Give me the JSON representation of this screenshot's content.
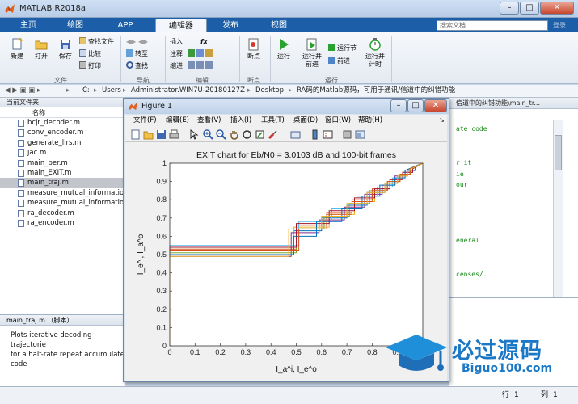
{
  "app": {
    "title": "MATLAB R2018a"
  },
  "tabs": [
    {
      "label": "主页",
      "active": false
    },
    {
      "label": "绘图",
      "active": false
    },
    {
      "label": "APP",
      "active": false
    },
    {
      "label": "编辑器",
      "active": true
    },
    {
      "label": "发布",
      "active": false
    },
    {
      "label": "视图",
      "active": false
    }
  ],
  "search": {
    "placeholder": "搜索文档"
  },
  "login_label": "登录",
  "window_controls": {
    "minimize": "–",
    "maximize": "□",
    "close": "✕"
  },
  "ribbon": {
    "file": {
      "new": "新建",
      "open": "打开",
      "save": "保存",
      "find_files": "查找文件",
      "compare": "比较",
      "print": "打印",
      "group": "文件"
    },
    "nav": {
      "goto": "转至",
      "find": "查找",
      "group": "导航"
    },
    "edit": {
      "insert": "插入",
      "fx": "fx",
      "comment": "注释",
      "indent": "缩进",
      "group": "编辑"
    },
    "breakpoints": {
      "label": "断点",
      "group": "断点"
    },
    "run": {
      "run": "运行",
      "run_advance": "运行并\n前进",
      "run_section": "运行节",
      "advance": "前进",
      "run_time": "运行并\n计时",
      "group": "运行"
    }
  },
  "path": {
    "segments": [
      "C:",
      "Users",
      "Administrator.WIN7U-20180127Z",
      "Desktop",
      "RA码的Matlab源码，可用于通讯/信道中的纠错功能"
    ]
  },
  "current_folder": {
    "title": "当前文件夹",
    "column": "名称",
    "files": [
      {
        "name": "bcjr_decoder.m",
        "selected": false
      },
      {
        "name": "conv_encoder.m",
        "selected": false
      },
      {
        "name": "generate_llrs.m",
        "selected": false
      },
      {
        "name": "jac.m",
        "selected": false
      },
      {
        "name": "main_ber.m",
        "selected": false
      },
      {
        "name": "main_EXIT.m",
        "selected": false
      },
      {
        "name": "main_traj.m",
        "selected": true
      },
      {
        "name": "measure_mutual_information",
        "selected": false
      },
      {
        "name": "measure_mutual_information",
        "selected": false
      },
      {
        "name": "ra_decoder.m",
        "selected": false
      },
      {
        "name": "ra_encoder.m",
        "selected": false
      }
    ]
  },
  "details": {
    "header": "main_traj.m （脚本）",
    "lines": [
      "Plots iterative decoding trajectorie",
      "for a half-rate repeat accumulate",
      "code"
    ]
  },
  "editor": {
    "tab": "信道中的纠错功能\\main_tr...",
    "lines": [
      "ate code",
      "r it",
      "ie",
      "our",
      "eneral",
      "censes/."
    ]
  },
  "status": {
    "line_label": "行",
    "line_value": "1",
    "col_label": "列",
    "col_value": "1"
  },
  "figure": {
    "title": "Figure 1",
    "menu": [
      "文件(F)",
      "编辑(E)",
      "查看(V)",
      "插入(I)",
      "工具(T)",
      "桌面(D)",
      "窗口(W)",
      "帮助(H)"
    ],
    "controls": {
      "minimize": "–",
      "maximize": "□",
      "close": "✕"
    }
  },
  "chart_data": {
    "type": "line",
    "title": "EXIT chart for Eb/N0 = 3.0103 dB and 100-bit frames",
    "xlabel": "I_a^i, I_e^o",
    "ylabel": "I_e^i, I_a^o",
    "xlim": [
      0,
      1
    ],
    "ylim": [
      0,
      1
    ],
    "xticks": [
      0,
      0.1,
      0.2,
      0.3,
      0.4,
      0.5,
      0.6,
      0.7,
      0.8,
      0.9
    ],
    "yticks": [
      0,
      0.1,
      0.2,
      0.3,
      0.4,
      0.5,
      0.6,
      0.7,
      0.8,
      0.9,
      1
    ],
    "grid": false,
    "series": [
      {
        "color": "#0072bd",
        "points": [
          [
            0,
            0
          ],
          [
            0,
            0.5
          ],
          [
            0.49,
            0.5
          ],
          [
            0.49,
            0.63
          ],
          [
            0.6,
            0.63
          ],
          [
            0.6,
            0.7
          ],
          [
            0.7,
            0.7
          ],
          [
            0.7,
            0.77
          ],
          [
            0.78,
            0.77
          ],
          [
            0.78,
            0.84
          ],
          [
            0.85,
            0.84
          ],
          [
            0.85,
            0.89
          ],
          [
            0.9,
            0.89
          ],
          [
            0.9,
            0.93
          ],
          [
            0.94,
            0.93
          ],
          [
            0.94,
            0.96
          ],
          [
            0.97,
            0.96
          ],
          [
            0.97,
            0.98
          ],
          [
            1,
            1
          ]
        ]
      },
      {
        "color": "#d95319",
        "points": [
          [
            0,
            0
          ],
          [
            0,
            0.53
          ],
          [
            0.5,
            0.53
          ],
          [
            0.5,
            0.66
          ],
          [
            0.62,
            0.66
          ],
          [
            0.62,
            0.73
          ],
          [
            0.72,
            0.73
          ],
          [
            0.72,
            0.8
          ],
          [
            0.8,
            0.8
          ],
          [
            0.8,
            0.86
          ],
          [
            0.87,
            0.86
          ],
          [
            0.87,
            0.91
          ],
          [
            0.92,
            0.91
          ],
          [
            0.92,
            0.95
          ],
          [
            0.96,
            0.95
          ],
          [
            0.96,
            0.98
          ],
          [
            1,
            1
          ]
        ]
      },
      {
        "color": "#edb120",
        "points": [
          [
            0,
            0
          ],
          [
            0,
            0.52
          ],
          [
            0.49,
            0.52
          ],
          [
            0.49,
            0.65
          ],
          [
            0.63,
            0.65
          ],
          [
            0.63,
            0.72
          ],
          [
            0.73,
            0.72
          ],
          [
            0.73,
            0.79
          ],
          [
            0.81,
            0.79
          ],
          [
            0.81,
            0.85
          ],
          [
            0.86,
            0.85
          ],
          [
            0.86,
            0.9
          ],
          [
            0.91,
            0.9
          ],
          [
            0.91,
            0.94
          ],
          [
            0.95,
            0.94
          ],
          [
            0.95,
            0.97
          ],
          [
            1,
            1
          ]
        ]
      },
      {
        "color": "#7e2f8e",
        "points": [
          [
            0,
            0
          ],
          [
            0,
            0.49
          ],
          [
            0.48,
            0.49
          ],
          [
            0.48,
            0.62
          ],
          [
            0.59,
            0.62
          ],
          [
            0.59,
            0.69
          ],
          [
            0.69,
            0.69
          ],
          [
            0.69,
            0.76
          ],
          [
            0.77,
            0.76
          ],
          [
            0.77,
            0.83
          ],
          [
            0.84,
            0.83
          ],
          [
            0.84,
            0.88
          ],
          [
            0.89,
            0.88
          ],
          [
            0.89,
            0.93
          ],
          [
            0.93,
            0.93
          ],
          [
            0.93,
            0.96
          ],
          [
            1,
            1
          ]
        ]
      },
      {
        "color": "#77ac30",
        "points": [
          [
            0,
            0
          ],
          [
            0,
            0.51
          ],
          [
            0.5,
            0.51
          ],
          [
            0.5,
            0.64
          ],
          [
            0.61,
            0.64
          ],
          [
            0.61,
            0.71
          ],
          [
            0.71,
            0.71
          ],
          [
            0.71,
            0.78
          ],
          [
            0.79,
            0.78
          ],
          [
            0.79,
            0.85
          ],
          [
            0.86,
            0.85
          ],
          [
            0.86,
            0.9
          ],
          [
            0.91,
            0.9
          ],
          [
            0.91,
            0.94
          ],
          [
            0.95,
            0.94
          ],
          [
            0.95,
            0.97
          ],
          [
            1,
            1
          ]
        ]
      },
      {
        "color": "#4dbeee",
        "points": [
          [
            0,
            0
          ],
          [
            0,
            0.55
          ],
          [
            0.51,
            0.55
          ],
          [
            0.51,
            0.68
          ],
          [
            0.64,
            0.68
          ],
          [
            0.64,
            0.75
          ],
          [
            0.74,
            0.75
          ],
          [
            0.74,
            0.82
          ],
          [
            0.82,
            0.82
          ],
          [
            0.82,
            0.87
          ],
          [
            0.88,
            0.87
          ],
          [
            0.88,
            0.92
          ],
          [
            0.93,
            0.92
          ],
          [
            0.93,
            0.95
          ],
          [
            0.96,
            0.95
          ],
          [
            0.96,
            0.98
          ],
          [
            1,
            1
          ]
        ]
      },
      {
        "color": "#a2142f",
        "points": [
          [
            0,
            0
          ],
          [
            0,
            0.54
          ],
          [
            0.5,
            0.54
          ],
          [
            0.5,
            0.67
          ],
          [
            0.63,
            0.67
          ],
          [
            0.63,
            0.74
          ],
          [
            0.73,
            0.74
          ],
          [
            0.73,
            0.81
          ],
          [
            0.81,
            0.81
          ],
          [
            0.81,
            0.86
          ],
          [
            0.87,
            0.86
          ],
          [
            0.87,
            0.91
          ],
          [
            0.92,
            0.91
          ],
          [
            0.92,
            0.95
          ],
          [
            0.96,
            0.95
          ],
          [
            0.96,
            0.97
          ],
          [
            1,
            1
          ]
        ]
      },
      {
        "color": "#0072bd",
        "points": [
          [
            0,
            0
          ],
          [
            0,
            0.5
          ],
          [
            0.49,
            0.5
          ],
          [
            0.49,
            0.6
          ],
          [
            0.58,
            0.6
          ],
          [
            0.58,
            0.68
          ],
          [
            0.68,
            0.68
          ],
          [
            0.68,
            0.75
          ],
          [
            0.76,
            0.75
          ],
          [
            0.76,
            0.82
          ],
          [
            0.83,
            0.82
          ],
          [
            0.83,
            0.88
          ],
          [
            0.89,
            0.88
          ],
          [
            0.89,
            0.92
          ],
          [
            0.93,
            0.92
          ],
          [
            0.93,
            0.96
          ],
          [
            1,
            1
          ]
        ]
      },
      {
        "color": "#d95319",
        "points": [
          [
            0,
            0
          ],
          [
            0,
            0.52
          ],
          [
            0.51,
            0.52
          ],
          [
            0.51,
            0.64
          ],
          [
            0.62,
            0.64
          ],
          [
            0.62,
            0.72
          ],
          [
            0.72,
            0.72
          ],
          [
            0.72,
            0.79
          ],
          [
            0.8,
            0.79
          ],
          [
            0.8,
            0.85
          ],
          [
            0.86,
            0.85
          ],
          [
            0.86,
            0.9
          ],
          [
            0.91,
            0.9
          ],
          [
            0.91,
            0.94
          ],
          [
            0.95,
            0.94
          ],
          [
            0.95,
            0.97
          ],
          [
            1,
            1
          ]
        ]
      },
      {
        "color": "#edb120",
        "points": [
          [
            0,
            0
          ],
          [
            0,
            0.49
          ],
          [
            0.47,
            0.49
          ],
          [
            0.47,
            0.64
          ],
          [
            0.6,
            0.64
          ],
          [
            0.6,
            0.71
          ],
          [
            0.7,
            0.71
          ],
          [
            0.7,
            0.78
          ],
          [
            0.78,
            0.78
          ],
          [
            0.78,
            0.84
          ],
          [
            0.85,
            0.84
          ],
          [
            0.85,
            0.89
          ],
          [
            0.9,
            0.89
          ],
          [
            0.9,
            0.93
          ],
          [
            0.94,
            0.93
          ],
          [
            0.94,
            0.96
          ],
          [
            1,
            1
          ]
        ]
      }
    ]
  },
  "watermark": {
    "brand": "必过源码",
    "url": "Biguo100.com"
  },
  "colors": {
    "accent": "#1c5fa8",
    "selected_row": "#c2c6cc"
  }
}
